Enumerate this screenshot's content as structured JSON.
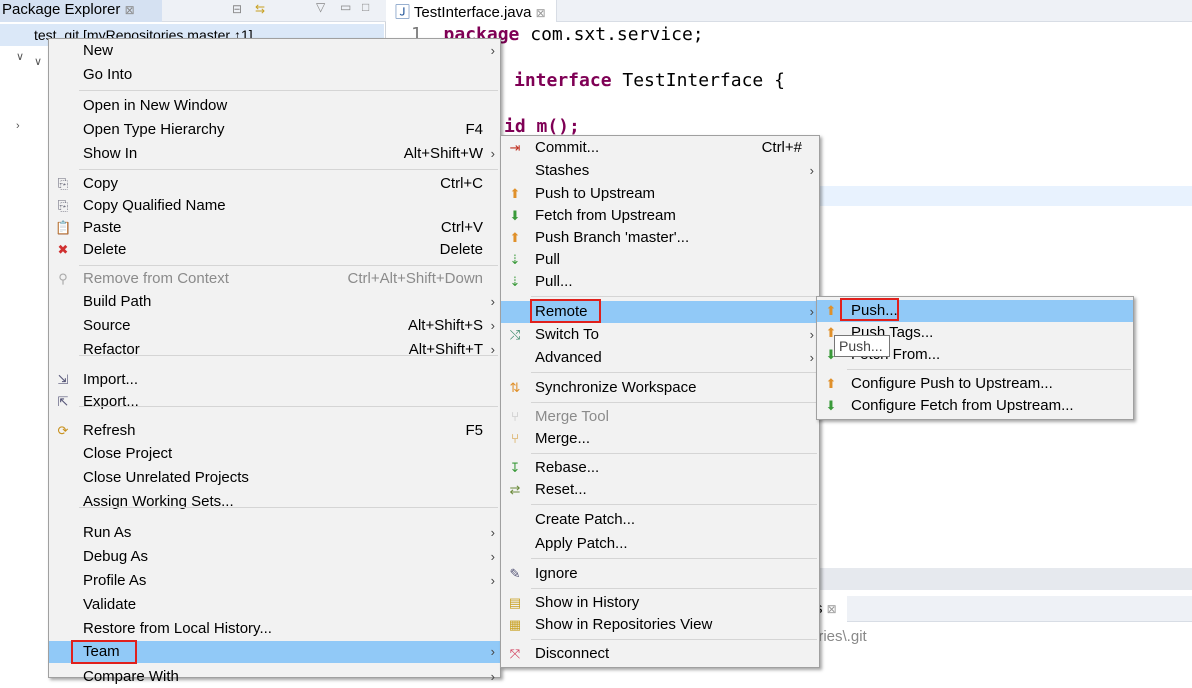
{
  "package_explorer": {
    "tab_label": "Package Explorer",
    "project_label": "test_git [myRepositories master ↑1]"
  },
  "editor": {
    "tab_label": "TestInterface.java",
    "lines": [
      {
        "num": "1",
        "kw": "package",
        "rest": " com.sxt.service;"
      },
      {
        "num": "",
        "kw": "interface",
        "rest": " TestInterface {"
      },
      {
        "num": "",
        "kw": "",
        "rest": "id m();"
      }
    ]
  },
  "bottom_panel": {
    "tab_label": "s",
    "path_text": "ories\\.git"
  },
  "tooltip": "Push...",
  "main_menu": [
    {
      "label": "New",
      "arrow": true
    },
    {
      "label": "Go Into"
    },
    {
      "sep": true
    },
    {
      "label": "Open in New Window"
    },
    {
      "label": "Open Type Hierarchy",
      "shortcut": "F4"
    },
    {
      "label": "Show In",
      "shortcut": "Alt+Shift+W",
      "arrow": true
    },
    {
      "sep": true
    },
    {
      "label": "Copy",
      "shortcut": "Ctrl+C",
      "icon": "copy-icon"
    },
    {
      "label": "Copy Qualified Name",
      "icon": "copy-qualified-name-icon"
    },
    {
      "label": "Paste",
      "shortcut": "Ctrl+V",
      "icon": "paste-icon"
    },
    {
      "label": "Delete",
      "shortcut": "Delete",
      "icon": "delete-icon"
    },
    {
      "sep": true
    },
    {
      "label": "Remove from Context",
      "shortcut": "Ctrl+Alt+Shift+Down",
      "disabled": true,
      "icon": "remove-context-icon"
    },
    {
      "label": "Build Path",
      "arrow": true
    },
    {
      "label": "Source",
      "shortcut": "Alt+Shift+S",
      "arrow": true
    },
    {
      "label": "Refactor",
      "shortcut": "Alt+Shift+T",
      "arrow": true
    },
    {
      "sep": true
    },
    {
      "label": "Import...",
      "icon": "import-icon"
    },
    {
      "label": "Export...",
      "icon": "export-icon"
    },
    {
      "sep": true
    },
    {
      "label": "Refresh",
      "shortcut": "F5",
      "icon": "refresh-icon"
    },
    {
      "label": "Close Project"
    },
    {
      "label": "Close Unrelated Projects"
    },
    {
      "label": "Assign Working Sets..."
    },
    {
      "sep": true
    },
    {
      "label": "Run As",
      "arrow": true
    },
    {
      "label": "Debug As",
      "arrow": true
    },
    {
      "label": "Profile As",
      "arrow": true
    },
    {
      "label": "Validate"
    },
    {
      "label": "Restore from Local History..."
    },
    {
      "label": "Team",
      "arrow": true,
      "selected": true
    },
    {
      "label": "Compare With",
      "arrow": true
    }
  ],
  "team_menu": [
    {
      "label": "Commit...",
      "shortcut": "Ctrl+#",
      "icon": "commit-icon"
    },
    {
      "label": "Stashes",
      "arrow": true
    },
    {
      "label": "Push to Upstream",
      "icon": "push-icon"
    },
    {
      "label": "Fetch from Upstream",
      "icon": "fetch-icon"
    },
    {
      "label": "Push Branch 'master'...",
      "icon": "push-branch-icon"
    },
    {
      "label": "Pull",
      "icon": "pull-icon"
    },
    {
      "label": "Pull...",
      "icon": "pull-icon"
    },
    {
      "sep": true
    },
    {
      "label": "Remote",
      "arrow": true,
      "selected": true
    },
    {
      "label": "Switch To",
      "arrow": true,
      "icon": "switch-icon"
    },
    {
      "label": "Advanced",
      "arrow": true
    },
    {
      "sep": true
    },
    {
      "label": "Synchronize Workspace",
      "icon": "synchronize-icon"
    },
    {
      "sep": true
    },
    {
      "label": "Merge Tool",
      "disabled": true,
      "icon": "merge-tool-icon"
    },
    {
      "label": "Merge...",
      "icon": "merge-icon"
    },
    {
      "sep": true
    },
    {
      "label": "Rebase...",
      "icon": "rebase-icon"
    },
    {
      "label": "Reset...",
      "icon": "reset-icon"
    },
    {
      "sep": true
    },
    {
      "label": "Create Patch..."
    },
    {
      "label": "Apply Patch..."
    },
    {
      "sep": true
    },
    {
      "label": "Ignore",
      "icon": "ignore-icon"
    },
    {
      "sep": true
    },
    {
      "label": "Show in History",
      "icon": "history-icon"
    },
    {
      "label": "Show in Repositories View",
      "icon": "repositories-icon"
    },
    {
      "sep": true
    },
    {
      "label": "Disconnect",
      "icon": "disconnect-icon"
    }
  ],
  "remote_menu": [
    {
      "label": "Push...",
      "selected": true,
      "icon": "push-icon"
    },
    {
      "label": "Push Tags...",
      "icon": "push-tags-icon"
    },
    {
      "label": "Fetch From...",
      "icon": "fetch-icon"
    },
    {
      "sep": true
    },
    {
      "label": "Configure Push to Upstream...",
      "icon": "configure-push-icon"
    },
    {
      "label": "Configure Fetch from Upstream...",
      "icon": "configure-fetch-icon"
    }
  ],
  "colors": {
    "selection": "#91c9f7",
    "highlight_box": "#e0201c",
    "keyword": "#7f0055"
  }
}
